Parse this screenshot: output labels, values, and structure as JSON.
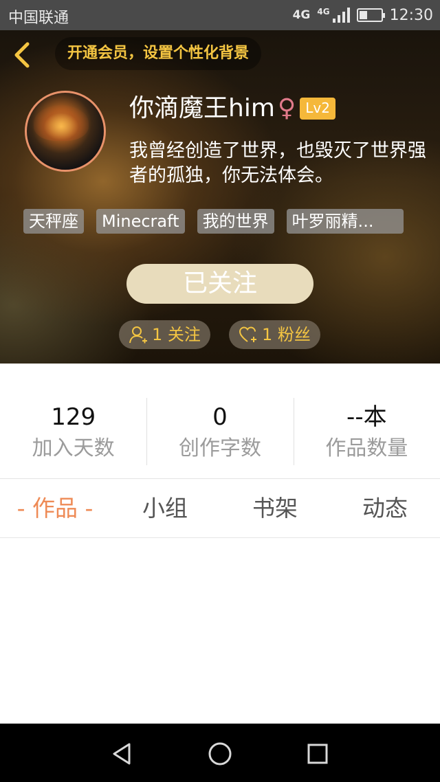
{
  "status_bar": {
    "carrier": "中国联通",
    "network_1": "4G",
    "network_2": "4G",
    "time": "12:30",
    "battery_level": 0.35
  },
  "header": {
    "vip_prompt": "开通会员，设置个性化背景",
    "username": "你滴魔王him",
    "gender_symbol": "♀",
    "level": "Lv2",
    "bio": "我曾经创造了世界，也毁灭了世界强者的孤独，你无法体会。",
    "tags": [
      "天秤座",
      "Minecraft",
      "我的世界",
      "叶罗丽精..."
    ],
    "follow_button": "已关注",
    "following": "1 关注",
    "fans": "1 粉丝"
  },
  "stats": [
    {
      "value": "129",
      "label": "加入天数"
    },
    {
      "value": "0",
      "label": "创作字数"
    },
    {
      "value": "--本",
      "label": "作品数量"
    }
  ],
  "tabs": [
    {
      "label": "- 作品 -",
      "active": true
    },
    {
      "label": "小组",
      "active": false
    },
    {
      "label": "书架",
      "active": false
    },
    {
      "label": "动态",
      "active": false
    }
  ],
  "colors": {
    "accent_orange": "#ee8a55",
    "vip_yellow": "#f4c542",
    "level_badge": "#f5b83a",
    "gender_pink": "#e07a8a",
    "follow_button_bg": "#e8dcbc"
  },
  "icons": {
    "back": "chevron-left-icon",
    "following": "person-plus-icon",
    "fans": "heart-plus-icon",
    "nav_back": "triangle-back-icon",
    "nav_home": "circle-home-icon",
    "nav_recent": "square-recent-icon"
  }
}
